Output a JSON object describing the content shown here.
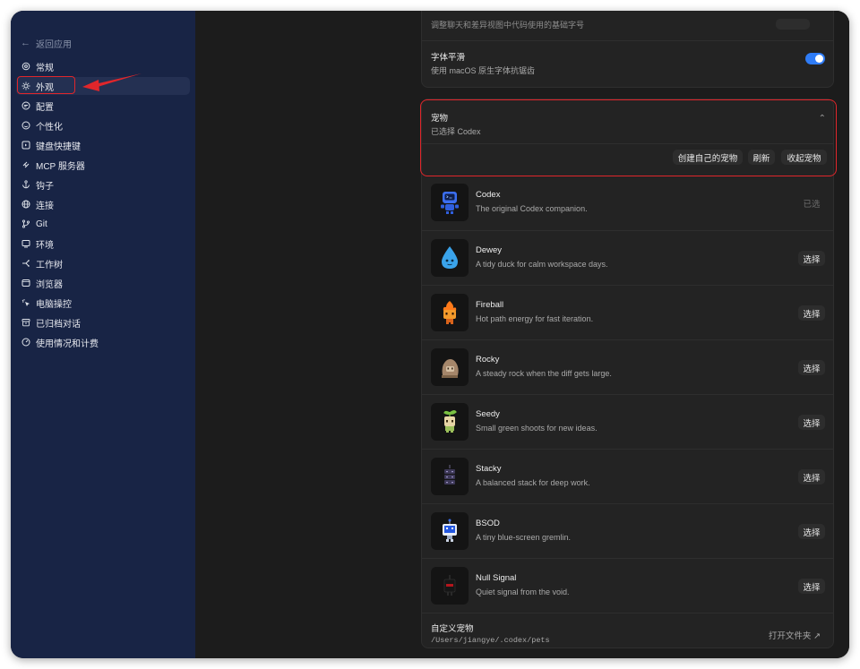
{
  "sidebar": {
    "back_label": "返回应用",
    "items": [
      {
        "label": "常规",
        "icon": "gear-icon"
      },
      {
        "label": "外观",
        "icon": "sun-icon"
      },
      {
        "label": "配置",
        "icon": "sliders-icon"
      },
      {
        "label": "个性化",
        "icon": "smile-icon"
      },
      {
        "label": "键盘快捷键",
        "icon": "keyboard-icon"
      },
      {
        "label": "MCP 服务器",
        "icon": "mcp-icon"
      },
      {
        "label": "钩子",
        "icon": "anchor-icon"
      },
      {
        "label": "连接",
        "icon": "globe-icon"
      },
      {
        "label": "Git",
        "icon": "git-branch-icon"
      },
      {
        "label": "环境",
        "icon": "monitor-icon"
      },
      {
        "label": "工作树",
        "icon": "worktree-icon"
      },
      {
        "label": "浏览器",
        "icon": "browser-icon"
      },
      {
        "label": "电脑操控",
        "icon": "cursor-icon"
      },
      {
        "label": "已归档对话",
        "icon": "archive-icon"
      },
      {
        "label": "使用情况和计费",
        "icon": "gauge-icon"
      }
    ],
    "active_index": 1
  },
  "appearance": {
    "clipped_row_text": "调整聊天和差异视图中代码使用的基础字号",
    "smoothing_title": "字体平滑",
    "smoothing_desc": "使用 macOS 原生字体抗锯齿",
    "smoothing_enabled": true
  },
  "pets": {
    "section_title": "宠物",
    "section_sub": "已选择 Codex",
    "btn_create": "创建自己的宠物",
    "btn_refresh": "刷新",
    "btn_collapse": "收起宠物",
    "list": [
      {
        "name": "Codex",
        "desc": "The original Codex companion.",
        "action": "已选",
        "selected": true,
        "icon": "codex-pet-icon"
      },
      {
        "name": "Dewey",
        "desc": "A tidy duck for calm workspace days.",
        "action": "选择",
        "selected": false,
        "icon": "dewey-pet-icon"
      },
      {
        "name": "Fireball",
        "desc": "Hot path energy for fast iteration.",
        "action": "选择",
        "selected": false,
        "icon": "fireball-pet-icon"
      },
      {
        "name": "Rocky",
        "desc": "A steady rock when the diff gets large.",
        "action": "选择",
        "selected": false,
        "icon": "rocky-pet-icon"
      },
      {
        "name": "Seedy",
        "desc": "Small green shoots for new ideas.",
        "action": "选择",
        "selected": false,
        "icon": "seedy-pet-icon"
      },
      {
        "name": "Stacky",
        "desc": "A balanced stack for deep work.",
        "action": "选择",
        "selected": false,
        "icon": "stacky-pet-icon"
      },
      {
        "name": "BSOD",
        "desc": "A tiny blue-screen gremlin.",
        "action": "选择",
        "selected": false,
        "icon": "bsod-pet-icon"
      },
      {
        "name": "Null Signal",
        "desc": "Quiet signal from the void.",
        "action": "选择",
        "selected": false,
        "icon": "null-signal-pet-icon"
      }
    ],
    "custom_title": "自定义宠物",
    "custom_path": "/Users/jiangye/.codex/pets",
    "open_folder": "打开文件夹 ↗"
  },
  "colors": {
    "sidebar_bg": "#182445",
    "content_bg": "#1c1c1c",
    "accent": "#2f7cf6",
    "annotation_red": "#e0262b"
  }
}
